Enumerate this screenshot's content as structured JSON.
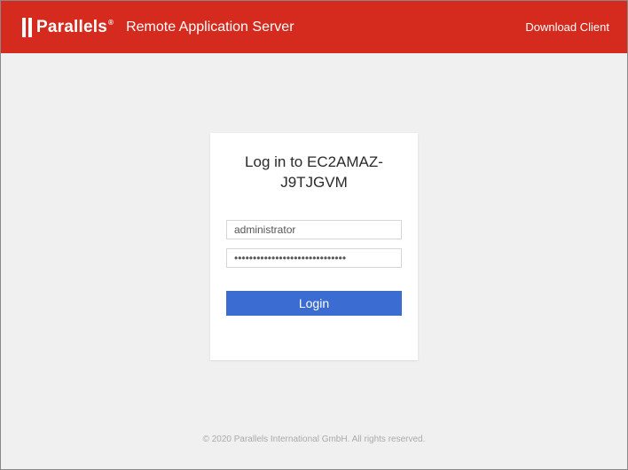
{
  "header": {
    "brand": "Parallels",
    "product_name": "Remote Application Server",
    "download_link": "Download Client"
  },
  "login": {
    "title": "Log in to EC2AMAZ-J9TJGVM",
    "username_value": "administrator",
    "password_value": "••••••••••••••••••••••••••••••",
    "button_label": "Login"
  },
  "footer": {
    "copyright": "© 2020 Parallels International GmbH. All rights reserved."
  }
}
